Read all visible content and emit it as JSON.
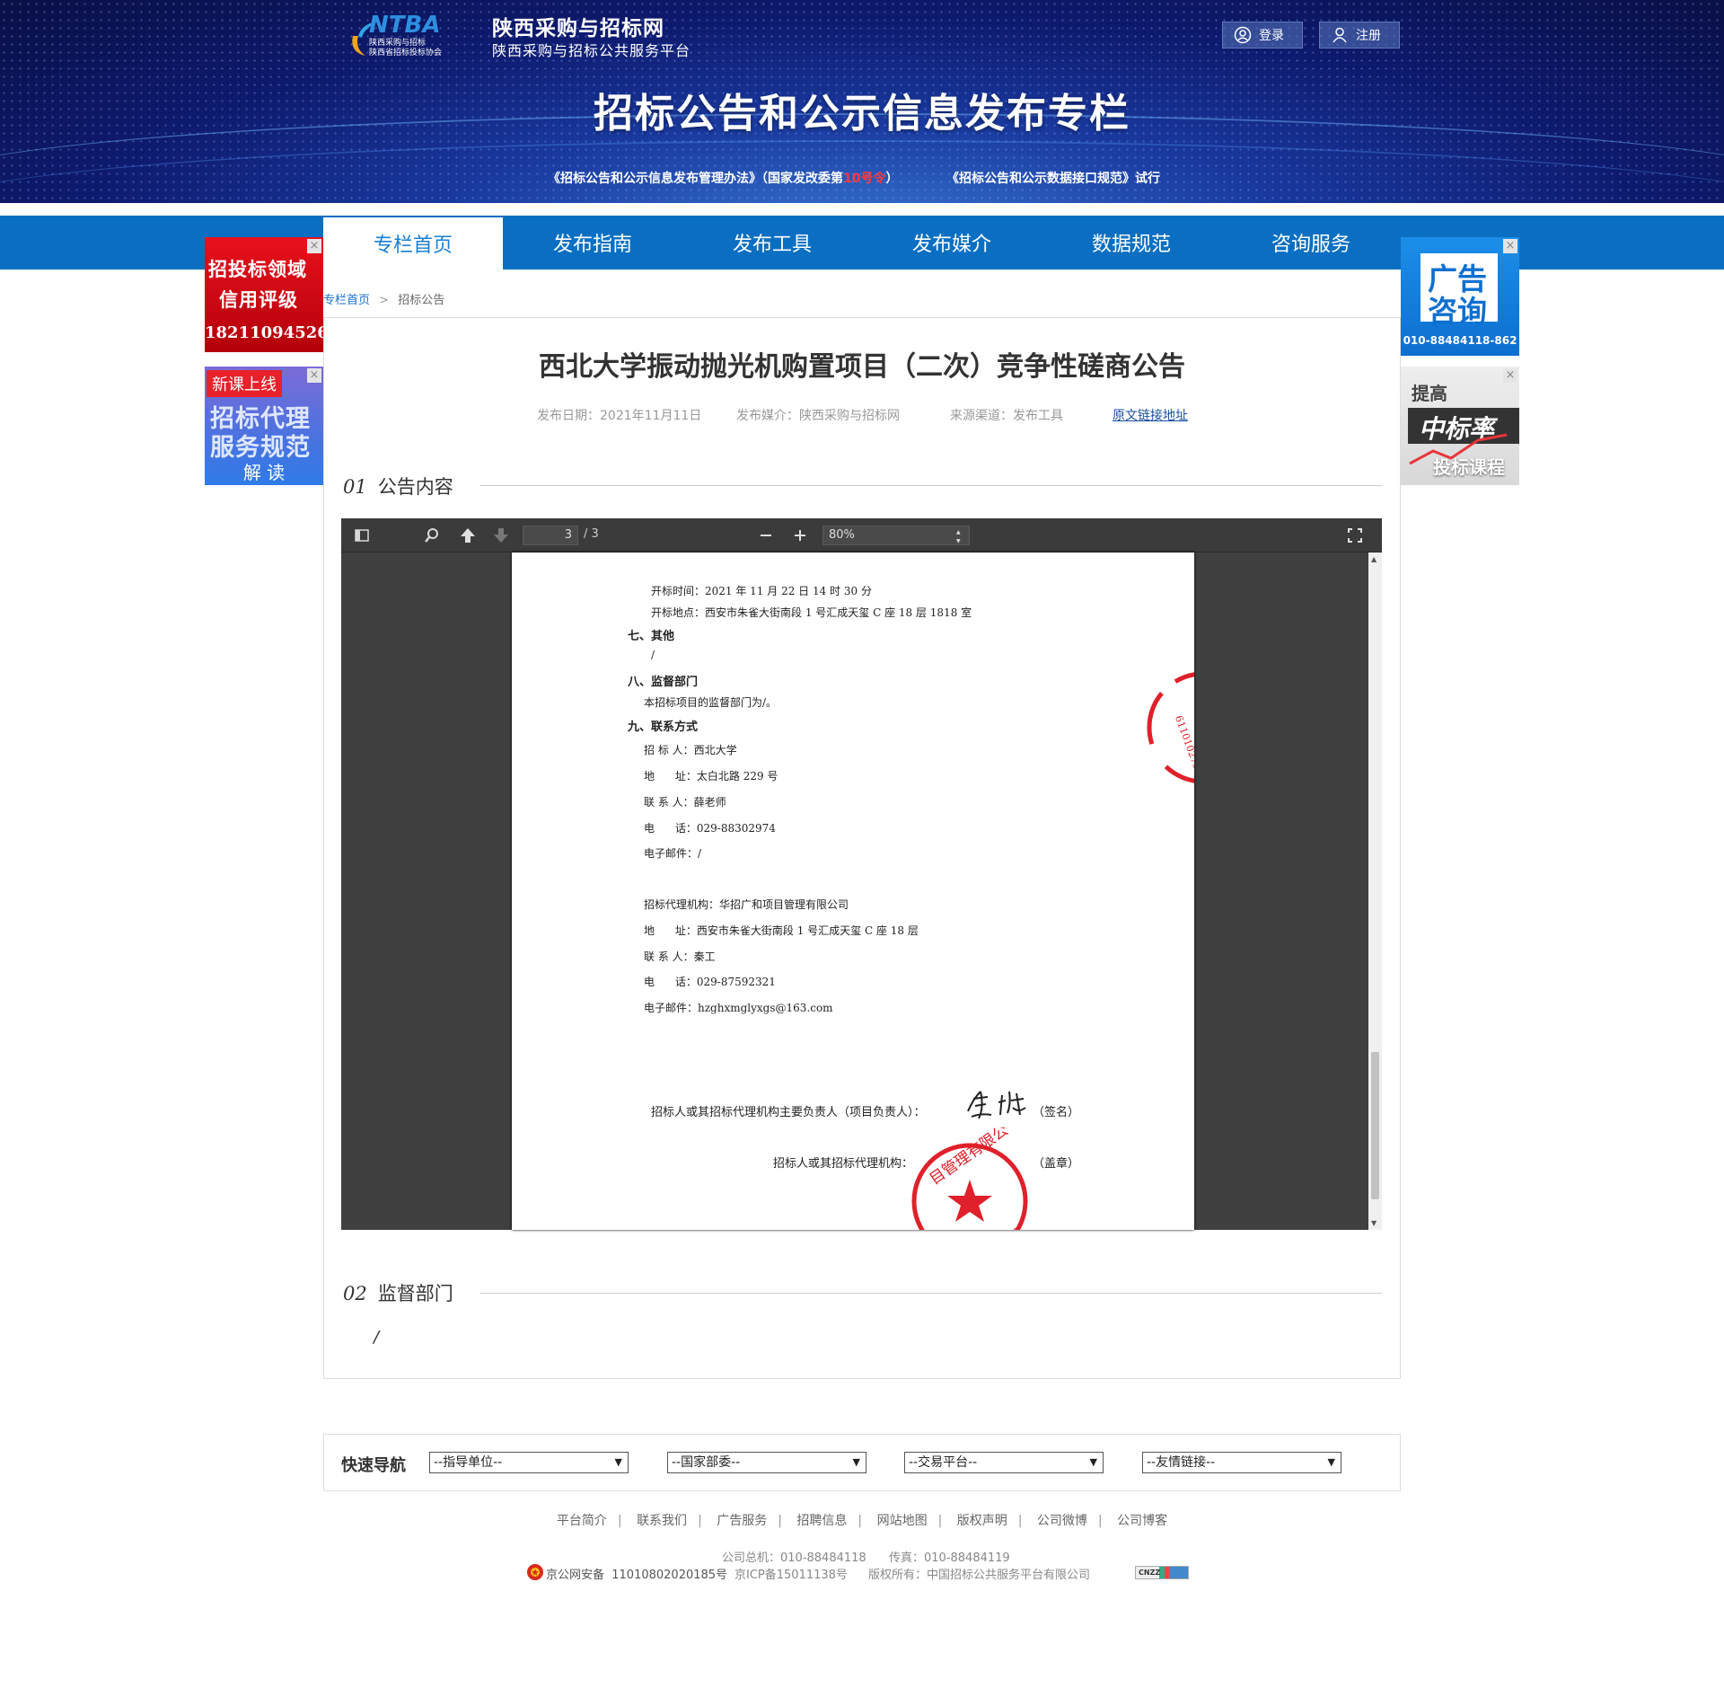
{
  "header": {
    "site_name": "陕西采购与招标网",
    "site_subtitle": "陕西采购与招标公共服务平台",
    "logo_letters": "NTBA",
    "logo_line1": "陕西采购与招标",
    "logo_line2": "陕西省招标投标协会",
    "login_label": "登录",
    "register_label": "注册",
    "banner_title": "招标公告和公示信息发布专栏",
    "notice_part1": "《招标公告和公示信息发布管理办法》（国家发改委第",
    "notice_red": "10号令",
    "notice_part2": "）",
    "notice_part3": "《招标公告和公示数据接口规范》试行"
  },
  "nav": {
    "items": [
      "专栏首页",
      "发布指南",
      "发布工具",
      "发布媒介",
      "数据规范",
      "咨询服务"
    ],
    "active_index": 0
  },
  "side_ads": {
    "left1": {
      "line1": "招投标领域",
      "line2": "信用评级",
      "phone": "18211094526"
    },
    "left2": {
      "tag": "新课上线",
      "line1": "招标代理",
      "line2": "服务规范",
      "line3": "解 读"
    },
    "right1": {
      "line1": "广告",
      "line2": "咨询",
      "phone": "010-88484118-862"
    },
    "right2": {
      "line1": "提高",
      "line2": "中标率",
      "line3": "投标课程"
    },
    "close_symbol": "×"
  },
  "breadcrumb": {
    "home": "专栏首页",
    "sep": ">",
    "current": "招标公告"
  },
  "article": {
    "title": "西北大学振动抛光机购置项目（二次）竞争性磋商公告",
    "publish_date": "发布日期：2021年11月11日",
    "publish_media": "发布媒介：陕西采购与招标网",
    "source_channel": "来源渠道：发布工具",
    "original_link": "原文链接地址"
  },
  "section1": {
    "num": "01",
    "title": "公告内容"
  },
  "section2": {
    "num": "02",
    "title": "监督部门",
    "value": "/"
  },
  "pdf_viewer": {
    "current_page": "3",
    "total_pages": "/ 3",
    "zoom": "80%",
    "lines": {
      "open_time": "开标时间：2021 年 11 月 22 日 14 时 30 分",
      "open_place": "开标地点：西安市朱雀大街南段 1 号汇成天玺 C 座 18 层 1818 室",
      "h7": "七、其他",
      "h7_val": "/",
      "h8": "八、监督部门",
      "h8_val": "本招标项目的监督部门为/。",
      "h9": "九、联系方式",
      "tenderer": "招 标 人：西北大学",
      "addr1": "地      址：太白北路 229 号",
      "contact1": "联 系 人：薛老师",
      "phone1": "电      话：029-88302974",
      "email1": "电子邮件：/",
      "agency": "招标代理机构：华招广和项目管理有限公司",
      "addr2": "地      址：西安市朱雀大街南段 1 号汇成天玺 C 座 18 层",
      "contact2": "联 系 人：秦工",
      "phone2": "电      话：029-87592321",
      "email2": "电子邮件：hzghxmglyxgs@163.com",
      "sign_line": "招标人或其招标代理机构主要负责人（项目负责人）：",
      "sign_suffix": "（签名）",
      "seal_line": "招标人或其招标代理机构：",
      "seal_suffix": "（盖章）"
    }
  },
  "quick_nav": {
    "label": "快速导航",
    "selects": [
      "--指导单位--",
      "--国家部委--",
      "--交易平台--",
      "--友情链接--"
    ]
  },
  "footer": {
    "links": [
      "平台简介",
      "联系我们",
      "广告服务",
      "招聘信息",
      "网站地图",
      "版权声明",
      "公司微博",
      "公司博客"
    ],
    "phone": "公司总机：010-88484118",
    "fax": "传真：010-88484119",
    "police": "京公网安备  11010802020185号",
    "icp": "京ICP备15011138号",
    "copyright": "版权所有：中国招标公共服务平台有限公司",
    "cnzz": "CNZZ"
  },
  "colors": {
    "nav_blue": "#0a6fc2",
    "active_text": "#1a7fd4",
    "seal_red": "#e0202a"
  }
}
